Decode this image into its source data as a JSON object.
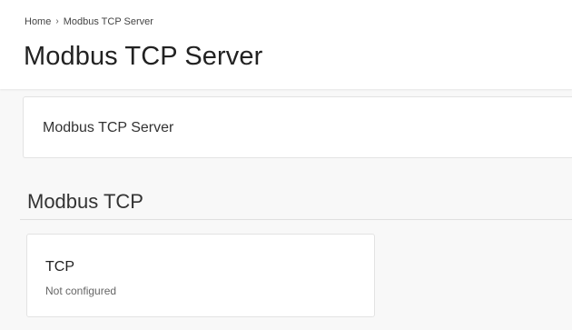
{
  "breadcrumb": {
    "home_label": "Home",
    "separator": "›",
    "current_label": "Modbus TCP Server"
  },
  "page": {
    "title": "Modbus TCP Server"
  },
  "summary_card": {
    "label": "Modbus TCP Server"
  },
  "section": {
    "title": "Modbus TCP"
  },
  "cards": [
    {
      "title": "TCP",
      "status": "Not configured"
    }
  ],
  "colors": {
    "background": "#f8f8f8",
    "surface": "#ffffff",
    "border": "#e3e3e3",
    "text_primary": "#222222",
    "text_secondary": "#666666"
  }
}
